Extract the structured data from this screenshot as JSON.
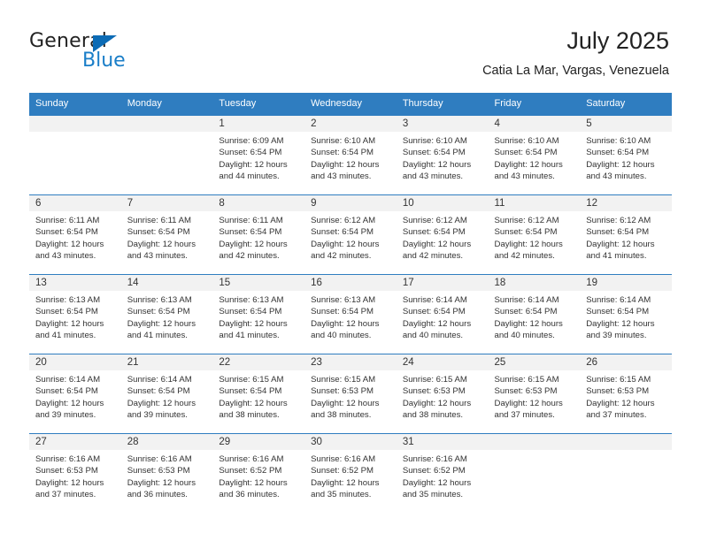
{
  "brand": {
    "name_part1": "General",
    "name_part2": "Blue",
    "triangle_color": "#0c6bb5",
    "blue_color": "#1a7ec8"
  },
  "header": {
    "title": "July 2025",
    "subtitle": "Catia La Mar, Vargas, Venezuela"
  },
  "colors": {
    "header_blue": "#2f7dc0",
    "daynum_band": "#f2f2f2",
    "text": "#333333"
  },
  "weekdays": [
    "Sunday",
    "Monday",
    "Tuesday",
    "Wednesday",
    "Thursday",
    "Friday",
    "Saturday"
  ],
  "weeks": [
    [
      {
        "day": "",
        "empty": true
      },
      {
        "day": "",
        "empty": true
      },
      {
        "day": "1",
        "sunrise": "Sunrise: 6:09 AM",
        "sunset": "Sunset: 6:54 PM",
        "daylight1": "Daylight: 12 hours",
        "daylight2": "and 44 minutes."
      },
      {
        "day": "2",
        "sunrise": "Sunrise: 6:10 AM",
        "sunset": "Sunset: 6:54 PM",
        "daylight1": "Daylight: 12 hours",
        "daylight2": "and 43 minutes."
      },
      {
        "day": "3",
        "sunrise": "Sunrise: 6:10 AM",
        "sunset": "Sunset: 6:54 PM",
        "daylight1": "Daylight: 12 hours",
        "daylight2": "and 43 minutes."
      },
      {
        "day": "4",
        "sunrise": "Sunrise: 6:10 AM",
        "sunset": "Sunset: 6:54 PM",
        "daylight1": "Daylight: 12 hours",
        "daylight2": "and 43 minutes."
      },
      {
        "day": "5",
        "sunrise": "Sunrise: 6:10 AM",
        "sunset": "Sunset: 6:54 PM",
        "daylight1": "Daylight: 12 hours",
        "daylight2": "and 43 minutes."
      }
    ],
    [
      {
        "day": "6",
        "sunrise": "Sunrise: 6:11 AM",
        "sunset": "Sunset: 6:54 PM",
        "daylight1": "Daylight: 12 hours",
        "daylight2": "and 43 minutes."
      },
      {
        "day": "7",
        "sunrise": "Sunrise: 6:11 AM",
        "sunset": "Sunset: 6:54 PM",
        "daylight1": "Daylight: 12 hours",
        "daylight2": "and 43 minutes."
      },
      {
        "day": "8",
        "sunrise": "Sunrise: 6:11 AM",
        "sunset": "Sunset: 6:54 PM",
        "daylight1": "Daylight: 12 hours",
        "daylight2": "and 42 minutes."
      },
      {
        "day": "9",
        "sunrise": "Sunrise: 6:12 AM",
        "sunset": "Sunset: 6:54 PM",
        "daylight1": "Daylight: 12 hours",
        "daylight2": "and 42 minutes."
      },
      {
        "day": "10",
        "sunrise": "Sunrise: 6:12 AM",
        "sunset": "Sunset: 6:54 PM",
        "daylight1": "Daylight: 12 hours",
        "daylight2": "and 42 minutes."
      },
      {
        "day": "11",
        "sunrise": "Sunrise: 6:12 AM",
        "sunset": "Sunset: 6:54 PM",
        "daylight1": "Daylight: 12 hours",
        "daylight2": "and 42 minutes."
      },
      {
        "day": "12",
        "sunrise": "Sunrise: 6:12 AM",
        "sunset": "Sunset: 6:54 PM",
        "daylight1": "Daylight: 12 hours",
        "daylight2": "and 41 minutes."
      }
    ],
    [
      {
        "day": "13",
        "sunrise": "Sunrise: 6:13 AM",
        "sunset": "Sunset: 6:54 PM",
        "daylight1": "Daylight: 12 hours",
        "daylight2": "and 41 minutes."
      },
      {
        "day": "14",
        "sunrise": "Sunrise: 6:13 AM",
        "sunset": "Sunset: 6:54 PM",
        "daylight1": "Daylight: 12 hours",
        "daylight2": "and 41 minutes."
      },
      {
        "day": "15",
        "sunrise": "Sunrise: 6:13 AM",
        "sunset": "Sunset: 6:54 PM",
        "daylight1": "Daylight: 12 hours",
        "daylight2": "and 41 minutes."
      },
      {
        "day": "16",
        "sunrise": "Sunrise: 6:13 AM",
        "sunset": "Sunset: 6:54 PM",
        "daylight1": "Daylight: 12 hours",
        "daylight2": "and 40 minutes."
      },
      {
        "day": "17",
        "sunrise": "Sunrise: 6:14 AM",
        "sunset": "Sunset: 6:54 PM",
        "daylight1": "Daylight: 12 hours",
        "daylight2": "and 40 minutes."
      },
      {
        "day": "18",
        "sunrise": "Sunrise: 6:14 AM",
        "sunset": "Sunset: 6:54 PM",
        "daylight1": "Daylight: 12 hours",
        "daylight2": "and 40 minutes."
      },
      {
        "day": "19",
        "sunrise": "Sunrise: 6:14 AM",
        "sunset": "Sunset: 6:54 PM",
        "daylight1": "Daylight: 12 hours",
        "daylight2": "and 39 minutes."
      }
    ],
    [
      {
        "day": "20",
        "sunrise": "Sunrise: 6:14 AM",
        "sunset": "Sunset: 6:54 PM",
        "daylight1": "Daylight: 12 hours",
        "daylight2": "and 39 minutes."
      },
      {
        "day": "21",
        "sunrise": "Sunrise: 6:14 AM",
        "sunset": "Sunset: 6:54 PM",
        "daylight1": "Daylight: 12 hours",
        "daylight2": "and 39 minutes."
      },
      {
        "day": "22",
        "sunrise": "Sunrise: 6:15 AM",
        "sunset": "Sunset: 6:54 PM",
        "daylight1": "Daylight: 12 hours",
        "daylight2": "and 38 minutes."
      },
      {
        "day": "23",
        "sunrise": "Sunrise: 6:15 AM",
        "sunset": "Sunset: 6:53 PM",
        "daylight1": "Daylight: 12 hours",
        "daylight2": "and 38 minutes."
      },
      {
        "day": "24",
        "sunrise": "Sunrise: 6:15 AM",
        "sunset": "Sunset: 6:53 PM",
        "daylight1": "Daylight: 12 hours",
        "daylight2": "and 38 minutes."
      },
      {
        "day": "25",
        "sunrise": "Sunrise: 6:15 AM",
        "sunset": "Sunset: 6:53 PM",
        "daylight1": "Daylight: 12 hours",
        "daylight2": "and 37 minutes."
      },
      {
        "day": "26",
        "sunrise": "Sunrise: 6:15 AM",
        "sunset": "Sunset: 6:53 PM",
        "daylight1": "Daylight: 12 hours",
        "daylight2": "and 37 minutes."
      }
    ],
    [
      {
        "day": "27",
        "sunrise": "Sunrise: 6:16 AM",
        "sunset": "Sunset: 6:53 PM",
        "daylight1": "Daylight: 12 hours",
        "daylight2": "and 37 minutes."
      },
      {
        "day": "28",
        "sunrise": "Sunrise: 6:16 AM",
        "sunset": "Sunset: 6:53 PM",
        "daylight1": "Daylight: 12 hours",
        "daylight2": "and 36 minutes."
      },
      {
        "day": "29",
        "sunrise": "Sunrise: 6:16 AM",
        "sunset": "Sunset: 6:52 PM",
        "daylight1": "Daylight: 12 hours",
        "daylight2": "and 36 minutes."
      },
      {
        "day": "30",
        "sunrise": "Sunrise: 6:16 AM",
        "sunset": "Sunset: 6:52 PM",
        "daylight1": "Daylight: 12 hours",
        "daylight2": "and 35 minutes."
      },
      {
        "day": "31",
        "sunrise": "Sunrise: 6:16 AM",
        "sunset": "Sunset: 6:52 PM",
        "daylight1": "Daylight: 12 hours",
        "daylight2": "and 35 minutes."
      },
      {
        "day": "",
        "empty": true
      },
      {
        "day": "",
        "empty": true
      }
    ]
  ]
}
